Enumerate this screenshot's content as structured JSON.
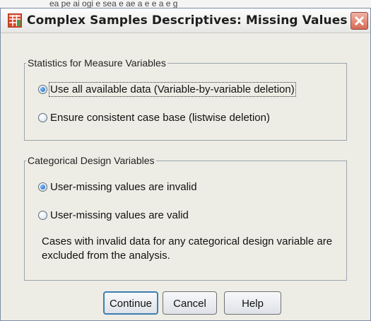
{
  "caption": "ea pe ai ogi e sea e ae a e e a e g",
  "window": {
    "title": "Complex Samples Descriptives: Missing Values"
  },
  "groups": [
    {
      "title": "Statistics for Measure Variables",
      "options": [
        {
          "label": "Use all available data (Variable-by-variable deletion)",
          "checked": true,
          "focused": true
        },
        {
          "label": "Ensure consistent case base (listwise deletion)",
          "checked": false
        }
      ]
    },
    {
      "title": "Categorical Design Variables",
      "options": [
        {
          "label": "User-missing values are invalid",
          "checked": true
        },
        {
          "label": "User-missing values are valid",
          "checked": false
        }
      ],
      "note": "Cases with invalid data for any categorical design variable are excluded from the analysis."
    }
  ],
  "buttons": {
    "continue": "Continue",
    "cancel": "Cancel",
    "help": "Help"
  },
  "icons": {
    "app": "spss-grid-icon",
    "close": "close-icon"
  },
  "colors": {
    "selected_radio": "#1a5fb4",
    "close_button": "#d86a55",
    "default_button_border": "#3c7fb1"
  }
}
